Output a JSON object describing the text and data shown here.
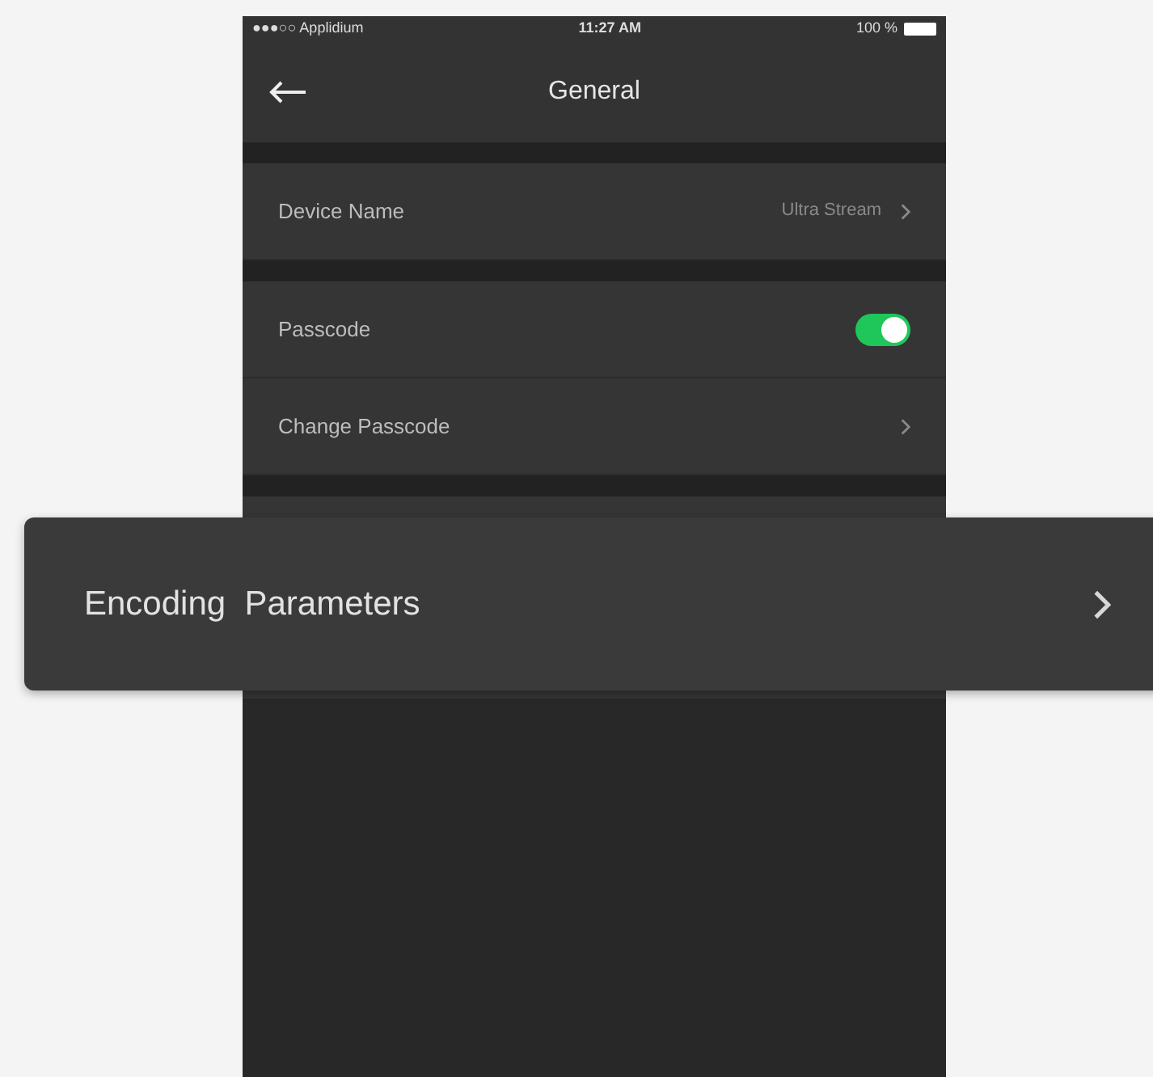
{
  "status_bar": {
    "carrier": "●●●○○ Applidium",
    "time": "11:27 AM",
    "battery": "100 %"
  },
  "nav": {
    "title": "General"
  },
  "sections": [
    {
      "rows": [
        {
          "kind": "link",
          "label": "Device Name",
          "value": "Ultra Stream"
        }
      ]
    },
    {
      "rows": [
        {
          "kind": "toggle",
          "label": "Passcode",
          "on": true
        },
        {
          "kind": "link",
          "label": "Change Passcode"
        }
      ]
    }
  ],
  "callout": {
    "label": "Encoding  Parameters"
  }
}
